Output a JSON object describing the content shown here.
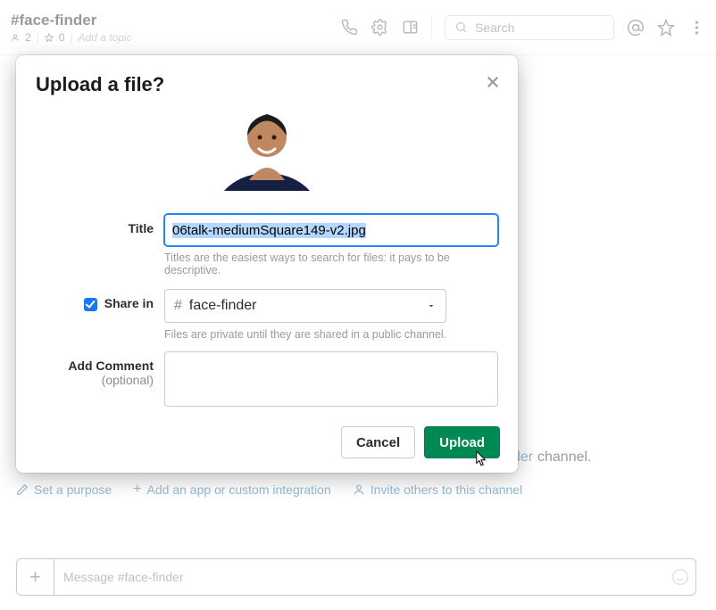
{
  "header": {
    "channel_title": "#face-finder",
    "members": "2",
    "pins": "0",
    "topic_placeholder": "Add a topic",
    "search_placeholder": "Search"
  },
  "background": {
    "channel_suffix": " channel.",
    "set_purpose": "Set a purpose",
    "add_app": "Add an app or custom integration",
    "invite": "Invite others to this channel",
    "compose_placeholder": "Message #face-finder",
    "der_fragment": "der"
  },
  "modal": {
    "title": "Upload a file?",
    "fields": {
      "title_label": "Title",
      "title_value": "06talk-mediumSquare149-v2.jpg",
      "title_help": "Titles are the easiest ways to search for files: it pays to be descriptive.",
      "share_label": "Share in",
      "share_channel": "face-finder",
      "share_help": "Files are private until they are shared in a public channel.",
      "comment_label": "Add Comment",
      "comment_sub": "(optional)"
    },
    "buttons": {
      "cancel": "Cancel",
      "upload": "Upload"
    }
  }
}
